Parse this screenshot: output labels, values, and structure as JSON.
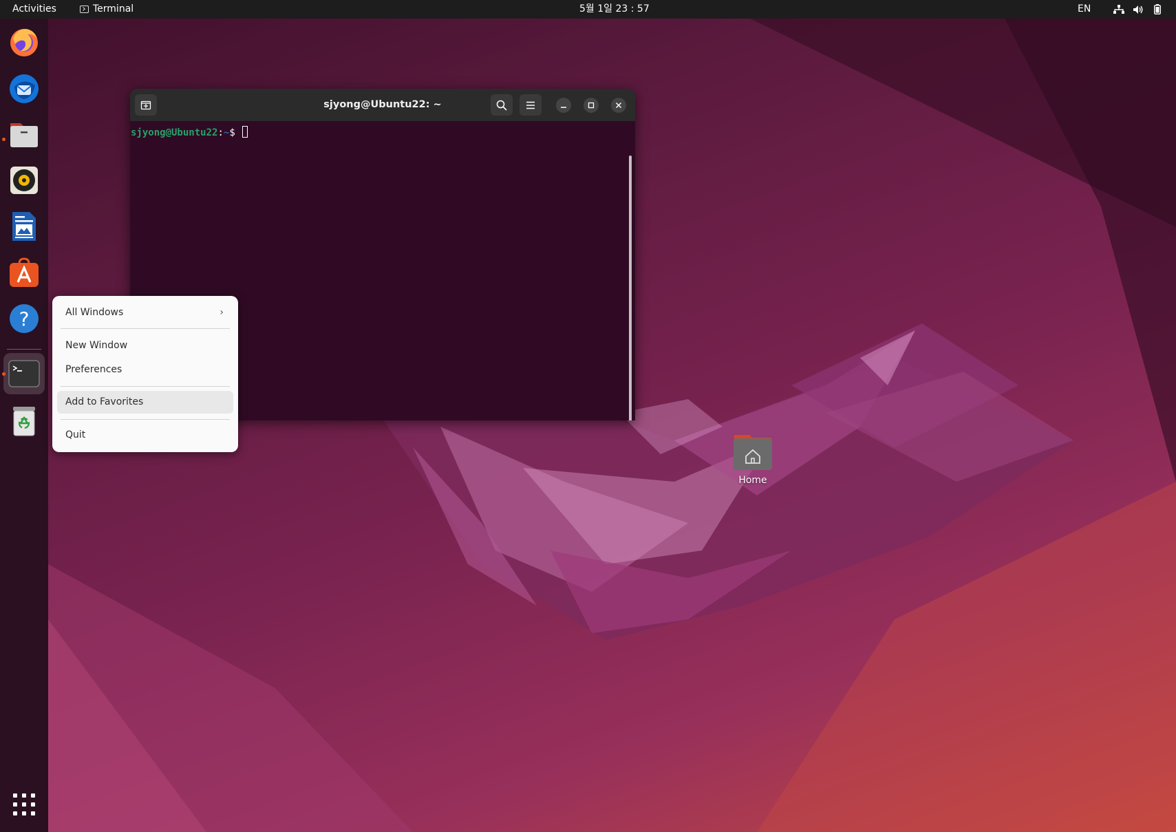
{
  "topbar": {
    "activities": "Activities",
    "app_name": "Terminal",
    "clock": "5월 1일  23 : 57",
    "lang": "EN",
    "icons": [
      "network-icon",
      "volume-icon",
      "battery-icon"
    ]
  },
  "dock": {
    "items": [
      {
        "name": "firefox",
        "icon": "firefox-icon"
      },
      {
        "name": "thunderbird",
        "icon": "thunderbird-icon"
      },
      {
        "name": "files",
        "icon": "files-icon",
        "running": true
      },
      {
        "name": "rhythmbox",
        "icon": "rhythmbox-icon"
      },
      {
        "name": "writer",
        "icon": "libreoffice-writer-icon"
      },
      {
        "name": "software",
        "icon": "app-center-icon"
      },
      {
        "name": "help",
        "icon": "help-icon"
      },
      {
        "name": "terminal",
        "icon": "terminal-icon",
        "running": true,
        "active": true
      },
      {
        "name": "trash",
        "icon": "trash-icon"
      }
    ],
    "apps_button_icon": "show-apps-grid-icon"
  },
  "terminal": {
    "title": "sjyong@Ubuntu22: ~",
    "prompt_user": "sjyong@Ubuntu22",
    "prompt_sep": ":",
    "prompt_path": "~",
    "prompt_symbol": "$",
    "colors": {
      "background": "#300a24",
      "user": "#26a269",
      "path": "#3465a4"
    }
  },
  "context_menu": {
    "all_windows": "All Windows",
    "new_window": "New Window",
    "preferences": "Preferences",
    "add_to_favorites": "Add to Favorites",
    "quit": "Quit",
    "highlighted": "Add to Favorites"
  },
  "desktop": {
    "home_label": "Home"
  },
  "colors": {
    "accent": "#e95420",
    "topbar": "#1d1d1d"
  }
}
